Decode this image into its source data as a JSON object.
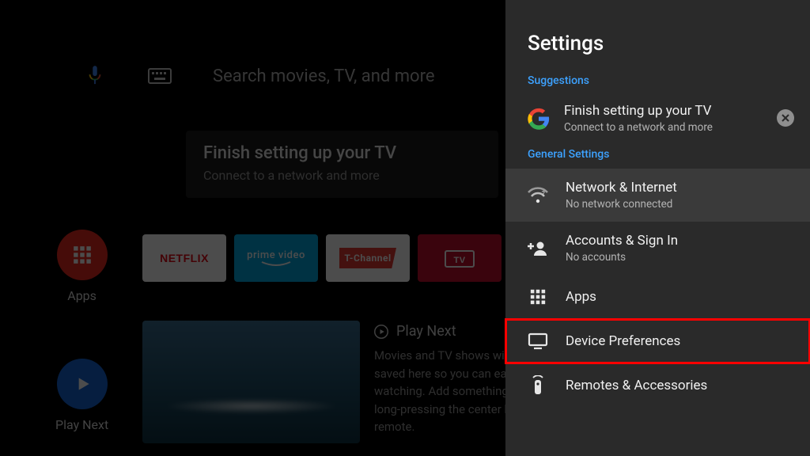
{
  "search": {
    "placeholder": "Search movies, TV, and more"
  },
  "home": {
    "setup": {
      "title": "Finish setting up your TV",
      "subtitle": "Connect to a network and more"
    },
    "left_nav": {
      "apps": "Apps",
      "play_next": "Play Next"
    },
    "app_tiles": {
      "netflix": "NETFLIX",
      "prime": "prime video",
      "tchannel": "T-Channel",
      "tv": "TV"
    },
    "play_next": {
      "heading": "Play Next",
      "body": "Movies and TV shows will automatically be saved here so you can easily resume watching. Add something to Play Next by long-pressing the center button on the remote."
    }
  },
  "panel": {
    "title": "Settings",
    "sections": {
      "suggestions": "Suggestions",
      "general": "General Settings"
    },
    "suggestion": {
      "title": "Finish setting up your TV",
      "subtitle": "Connect to a network and more"
    },
    "items": [
      {
        "title": "Network & Internet",
        "subtitle": "No network connected"
      },
      {
        "title": "Accounts & Sign In",
        "subtitle": "No accounts"
      },
      {
        "title": "Apps",
        "subtitle": ""
      },
      {
        "title": "Device Preferences",
        "subtitle": ""
      },
      {
        "title": "Remotes & Accessories",
        "subtitle": ""
      }
    ]
  }
}
